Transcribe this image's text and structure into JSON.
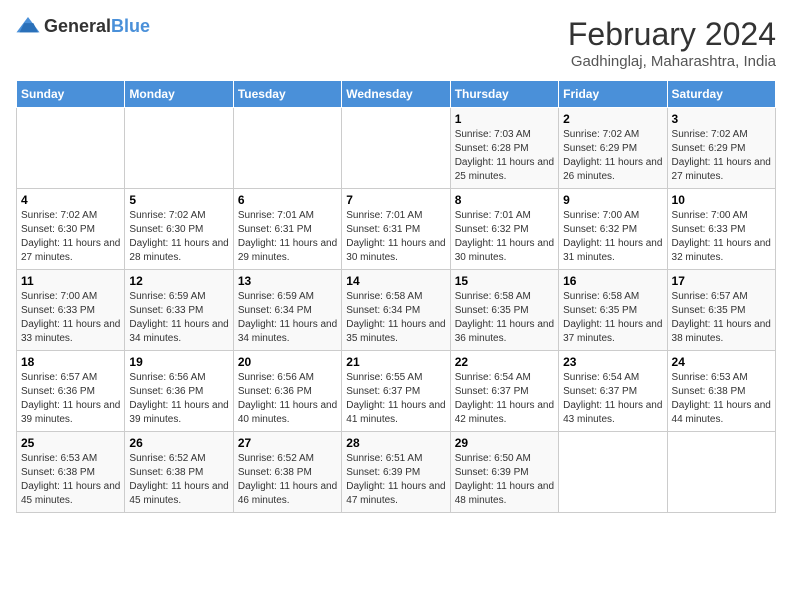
{
  "header": {
    "logo_general": "General",
    "logo_blue": "Blue",
    "title": "February 2024",
    "subtitle": "Gadhinglaj, Maharashtra, India"
  },
  "weekdays": [
    "Sunday",
    "Monday",
    "Tuesday",
    "Wednesday",
    "Thursday",
    "Friday",
    "Saturday"
  ],
  "weeks": [
    [
      {
        "day": "",
        "info": ""
      },
      {
        "day": "",
        "info": ""
      },
      {
        "day": "",
        "info": ""
      },
      {
        "day": "",
        "info": ""
      },
      {
        "day": "1",
        "info": "Sunrise: 7:03 AM\nSunset: 6:28 PM\nDaylight: 11 hours and 25 minutes."
      },
      {
        "day": "2",
        "info": "Sunrise: 7:02 AM\nSunset: 6:29 PM\nDaylight: 11 hours and 26 minutes."
      },
      {
        "day": "3",
        "info": "Sunrise: 7:02 AM\nSunset: 6:29 PM\nDaylight: 11 hours and 27 minutes."
      }
    ],
    [
      {
        "day": "4",
        "info": "Sunrise: 7:02 AM\nSunset: 6:30 PM\nDaylight: 11 hours and 27 minutes."
      },
      {
        "day": "5",
        "info": "Sunrise: 7:02 AM\nSunset: 6:30 PM\nDaylight: 11 hours and 28 minutes."
      },
      {
        "day": "6",
        "info": "Sunrise: 7:01 AM\nSunset: 6:31 PM\nDaylight: 11 hours and 29 minutes."
      },
      {
        "day": "7",
        "info": "Sunrise: 7:01 AM\nSunset: 6:31 PM\nDaylight: 11 hours and 30 minutes."
      },
      {
        "day": "8",
        "info": "Sunrise: 7:01 AM\nSunset: 6:32 PM\nDaylight: 11 hours and 30 minutes."
      },
      {
        "day": "9",
        "info": "Sunrise: 7:00 AM\nSunset: 6:32 PM\nDaylight: 11 hours and 31 minutes."
      },
      {
        "day": "10",
        "info": "Sunrise: 7:00 AM\nSunset: 6:33 PM\nDaylight: 11 hours and 32 minutes."
      }
    ],
    [
      {
        "day": "11",
        "info": "Sunrise: 7:00 AM\nSunset: 6:33 PM\nDaylight: 11 hours and 33 minutes."
      },
      {
        "day": "12",
        "info": "Sunrise: 6:59 AM\nSunset: 6:33 PM\nDaylight: 11 hours and 34 minutes."
      },
      {
        "day": "13",
        "info": "Sunrise: 6:59 AM\nSunset: 6:34 PM\nDaylight: 11 hours and 34 minutes."
      },
      {
        "day": "14",
        "info": "Sunrise: 6:58 AM\nSunset: 6:34 PM\nDaylight: 11 hours and 35 minutes."
      },
      {
        "day": "15",
        "info": "Sunrise: 6:58 AM\nSunset: 6:35 PM\nDaylight: 11 hours and 36 minutes."
      },
      {
        "day": "16",
        "info": "Sunrise: 6:58 AM\nSunset: 6:35 PM\nDaylight: 11 hours and 37 minutes."
      },
      {
        "day": "17",
        "info": "Sunrise: 6:57 AM\nSunset: 6:35 PM\nDaylight: 11 hours and 38 minutes."
      }
    ],
    [
      {
        "day": "18",
        "info": "Sunrise: 6:57 AM\nSunset: 6:36 PM\nDaylight: 11 hours and 39 minutes."
      },
      {
        "day": "19",
        "info": "Sunrise: 6:56 AM\nSunset: 6:36 PM\nDaylight: 11 hours and 39 minutes."
      },
      {
        "day": "20",
        "info": "Sunrise: 6:56 AM\nSunset: 6:36 PM\nDaylight: 11 hours and 40 minutes."
      },
      {
        "day": "21",
        "info": "Sunrise: 6:55 AM\nSunset: 6:37 PM\nDaylight: 11 hours and 41 minutes."
      },
      {
        "day": "22",
        "info": "Sunrise: 6:54 AM\nSunset: 6:37 PM\nDaylight: 11 hours and 42 minutes."
      },
      {
        "day": "23",
        "info": "Sunrise: 6:54 AM\nSunset: 6:37 PM\nDaylight: 11 hours and 43 minutes."
      },
      {
        "day": "24",
        "info": "Sunrise: 6:53 AM\nSunset: 6:38 PM\nDaylight: 11 hours and 44 minutes."
      }
    ],
    [
      {
        "day": "25",
        "info": "Sunrise: 6:53 AM\nSunset: 6:38 PM\nDaylight: 11 hours and 45 minutes."
      },
      {
        "day": "26",
        "info": "Sunrise: 6:52 AM\nSunset: 6:38 PM\nDaylight: 11 hours and 45 minutes."
      },
      {
        "day": "27",
        "info": "Sunrise: 6:52 AM\nSunset: 6:38 PM\nDaylight: 11 hours and 46 minutes."
      },
      {
        "day": "28",
        "info": "Sunrise: 6:51 AM\nSunset: 6:39 PM\nDaylight: 11 hours and 47 minutes."
      },
      {
        "day": "29",
        "info": "Sunrise: 6:50 AM\nSunset: 6:39 PM\nDaylight: 11 hours and 48 minutes."
      },
      {
        "day": "",
        "info": ""
      },
      {
        "day": "",
        "info": ""
      }
    ]
  ]
}
